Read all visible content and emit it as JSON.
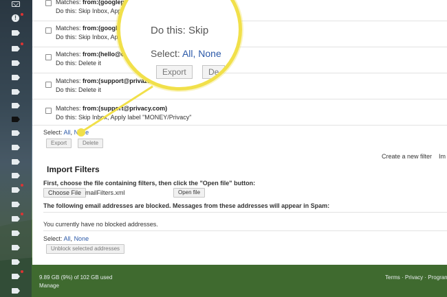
{
  "filters": [
    {
      "matches_label": "Matches:",
      "criteria": "from:(googleplay-noreply@google.com)",
      "action": "Do this: Skip Inbox, Apply label \"MONEY/Google Pay\""
    },
    {
      "matches_label": "Matches:",
      "criteria": "from:(googlepay-noreply@google.com)",
      "action": "Do this: Skip Inbox, Apply label \"MONEY/Google Pay\""
    },
    {
      "matches_label": "Matches:",
      "criteria": "from:(hello@crowdhold",
      "action": "Do this: Delete it"
    },
    {
      "matches_label": "Matches:",
      "criteria": "from:(support@privazer.com)",
      "action": "Do this: Delete it"
    },
    {
      "matches_label": "Matches:",
      "criteria": "from:(support@privacy.com)",
      "action": "Do this: Skip Inbox, Apply label \"MONEY/Privacy\""
    }
  ],
  "select": {
    "label": "Select:",
    "all": "All",
    "separator": ",",
    "none": "None"
  },
  "buttons": {
    "export": "Export",
    "delete": "Delete",
    "open_file": "Open file",
    "choose_file": "Choose File",
    "unblock": "Unblock selected addresses"
  },
  "links": {
    "create_filter": "Create a new filter",
    "import_truncated": "Im"
  },
  "import": {
    "title": "Import Filters",
    "instruction": "First, choose the file containing filters, then click the \"Open file\" button:",
    "file_name": "mailFilters.xml"
  },
  "blocked": {
    "notice": "The following email addresses are blocked. Messages from these addresses will appear in Spam:",
    "empty": "You currently have no blocked addresses.",
    "select_label": "Select:",
    "all": "All",
    "none": "None"
  },
  "footer": {
    "storage": "9.89 GB (9%) of 102 GB used",
    "manage": "Manage",
    "terms": "Terms",
    "dot": "·",
    "privacy": "Privacy",
    "program": "Program"
  },
  "magnifier": {
    "do_this": "Do this: Skip",
    "select_label": "Select:",
    "all": "All",
    "comma": ",",
    "none": "None",
    "export": "Export",
    "delete_partial": "De"
  },
  "colors": {
    "link": "#2a58a8",
    "highlight": "#f1e04a",
    "label_dot": "#dd3333"
  }
}
